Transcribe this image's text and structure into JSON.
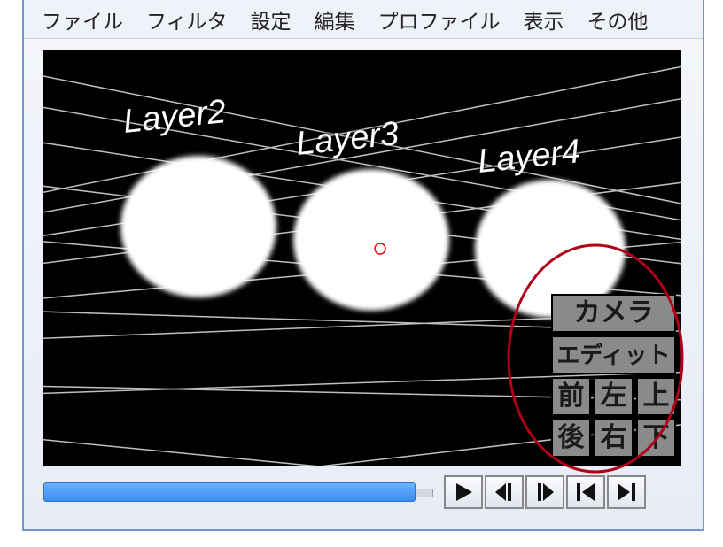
{
  "menu": {
    "file": "ファイル",
    "filter": "フィルタ",
    "settings": "設定",
    "edit": "編集",
    "profile": "プロファイル",
    "view": "表示",
    "other": "その他"
  },
  "viewport": {
    "labels": {
      "layer2": "Layer2",
      "layer3": "Layer3",
      "layer4": "Layer4"
    },
    "nav": {
      "camera": "カメラ",
      "edit": "エディット",
      "front": "前",
      "left": "左",
      "top": "上",
      "back": "後",
      "right": "右",
      "bottom": "下"
    }
  },
  "playback": {
    "slider_value_pct": 95
  }
}
